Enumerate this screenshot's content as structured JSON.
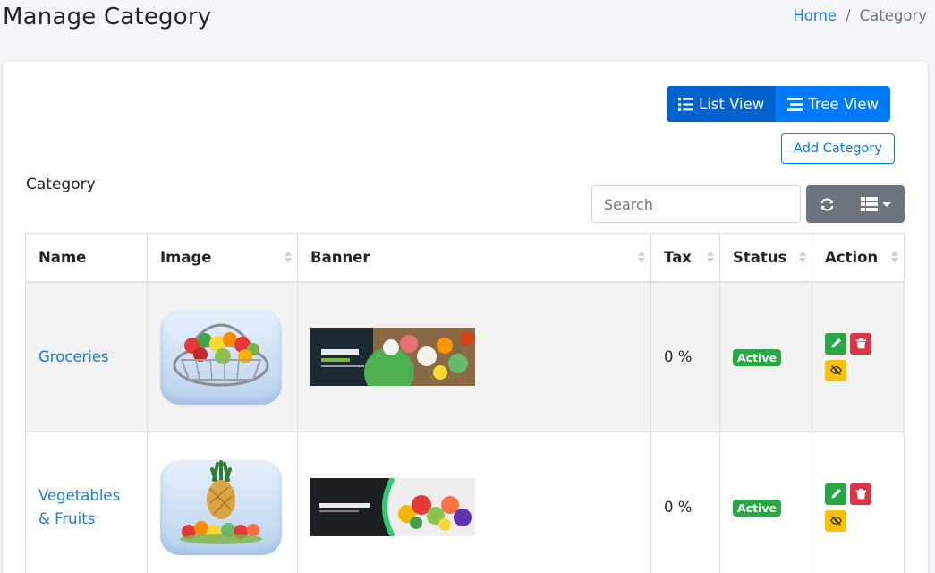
{
  "header": {
    "title": "Manage Category",
    "breadcrumb": {
      "home": "Home",
      "separator": "/",
      "current": "Category"
    }
  },
  "toolbar": {
    "list_view_label": "List View",
    "tree_view_label": "Tree View",
    "add_label": "Add Category",
    "section_label": "Category",
    "search_placeholder": "Search"
  },
  "table": {
    "columns": [
      "Name",
      "Image",
      "Banner",
      "Tax",
      "Status",
      "Action"
    ],
    "rows": [
      {
        "name": "Groceries",
        "tax": "0 %",
        "status": "Active",
        "image_icon": "grocery-basket-image",
        "banner_icon": "grocery-banner-image"
      },
      {
        "name": "Vegetables & Fruits",
        "tax": "0 %",
        "status": "Active",
        "image_icon": "pineapple-fruits-image",
        "banner_icon": "vegetables-fruits-banner-image"
      }
    ]
  },
  "colors": {
    "primary": "#007bff",
    "primary_active": "#0062cc",
    "success": "#28a745",
    "danger": "#dc3545",
    "warning": "#ffc107",
    "secondary": "#6c757d",
    "link": "#1e7bd8"
  }
}
